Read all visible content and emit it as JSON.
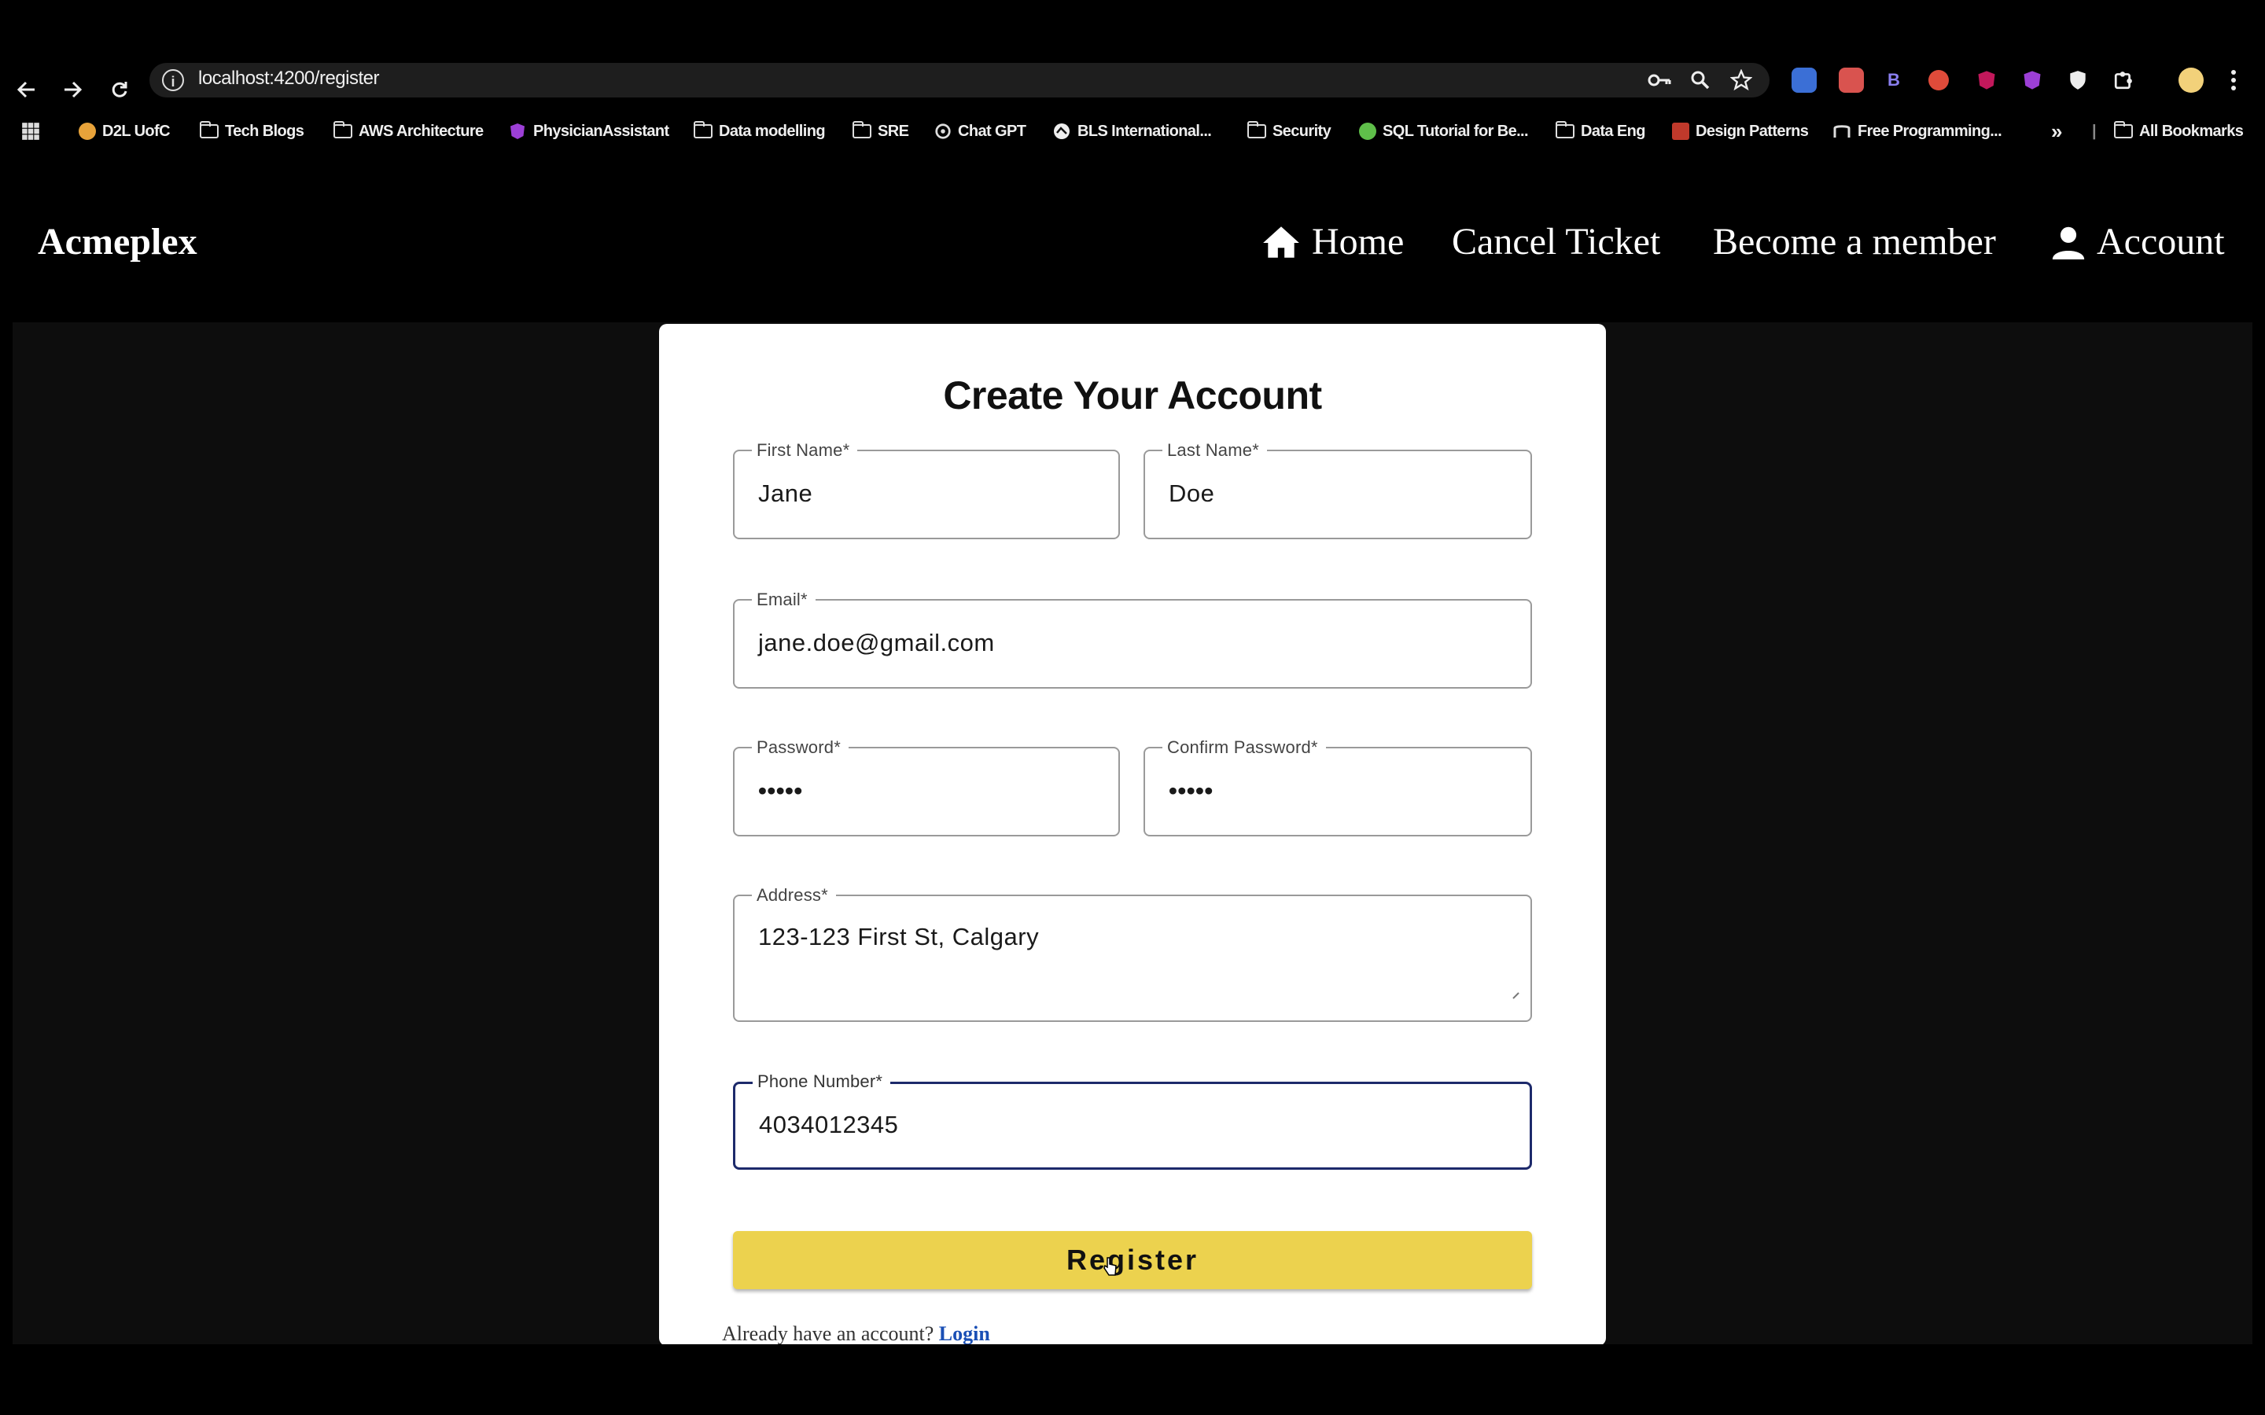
{
  "browser": {
    "url": "localhost:4200/register",
    "bookmarks": [
      {
        "label": "D2L UofC",
        "icon": "d2l-icon"
      },
      {
        "label": "Tech Blogs",
        "icon": "folder-icon"
      },
      {
        "label": "AWS Architecture",
        "icon": "folder-icon"
      },
      {
        "label": "PhysicianAssistant",
        "icon": "angular-icon"
      },
      {
        "label": "Data modelling",
        "icon": "folder-icon"
      },
      {
        "label": "SRE",
        "icon": "folder-icon"
      },
      {
        "label": "Chat GPT",
        "icon": "openai-icon"
      },
      {
        "label": "BLS International...",
        "icon": "globe-icon"
      },
      {
        "label": "Security",
        "icon": "folder-icon"
      },
      {
        "label": "SQL Tutorial for Be...",
        "icon": "site-icon"
      },
      {
        "label": "Data Eng",
        "icon": "folder-icon"
      },
      {
        "label": "Design Patterns",
        "icon": "site-icon"
      },
      {
        "label": "Free Programming...",
        "icon": "site-icon"
      }
    ],
    "all_bookmarks_label": "All Bookmarks"
  },
  "nav": {
    "brand": "Acmeplex",
    "home": "Home",
    "cancel_ticket": "Cancel Ticket",
    "become_member": "Become a member",
    "account": "Account"
  },
  "form": {
    "title": "Create Your Account",
    "first_name": {
      "label": "First Name",
      "value": "Jane"
    },
    "last_name": {
      "label": "Last Name",
      "value": "Doe"
    },
    "email": {
      "label": "Email",
      "value": "jane.doe@gmail.com"
    },
    "password": {
      "label": "Password",
      "value": "•••••"
    },
    "confirm_password": {
      "label": "Confirm Password",
      "value": "•••••"
    },
    "address": {
      "label": "Address",
      "value": "123-123 First St, Calgary"
    },
    "phone": {
      "label": "Phone Number",
      "value": "4034012345"
    },
    "required_marker": "*",
    "register_label": "Register",
    "login_prompt": "Already have an account?",
    "login_link": "Login"
  },
  "colors": {
    "register_button": "#ecd24e",
    "focus_border": "#1d2a6b",
    "login_link": "#1a4fb5"
  }
}
